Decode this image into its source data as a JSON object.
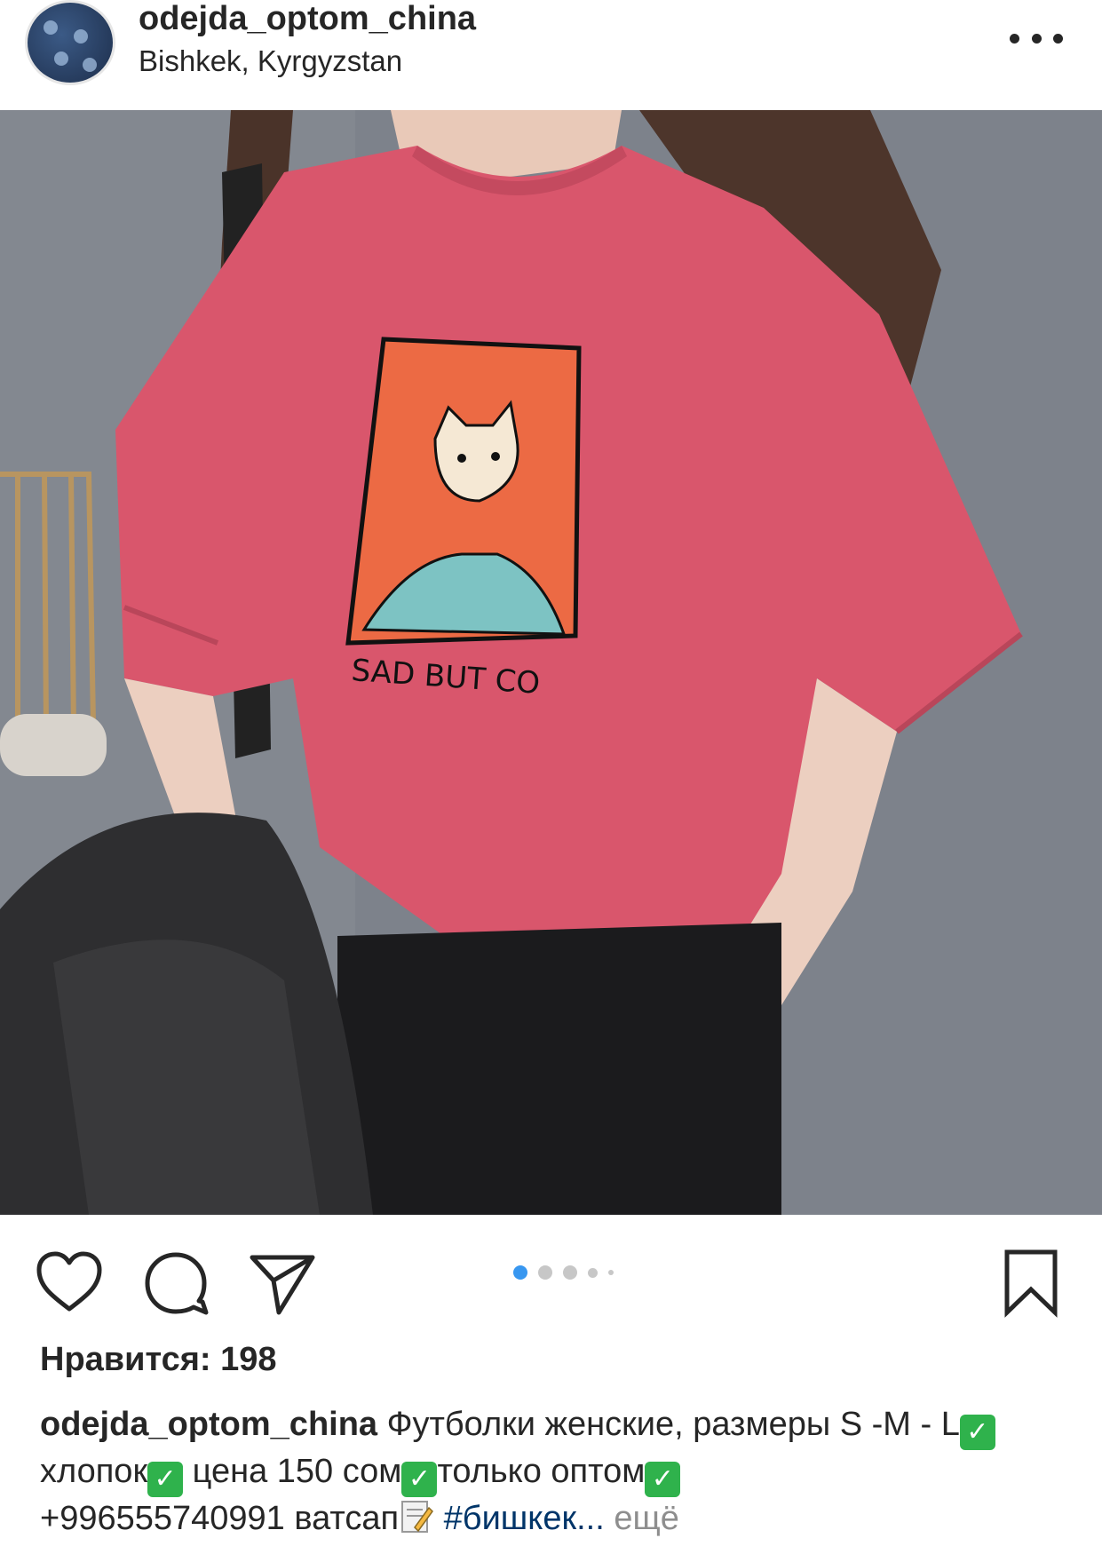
{
  "post": {
    "username": "odejda_optom_china",
    "location": "Bishkek, Kyrgyzstan",
    "shirt_print_text": "SAD BUT CO",
    "likes_label": "Нравится: 198",
    "carousel": {
      "pages": 5,
      "active_index": 0
    },
    "caption": {
      "username": "odejda_optom_china",
      "part1": " Футболки женские, размеры S -M - L",
      "part2": " хлопок",
      "part3": " цена 150 сом",
      "part4": "только оптом",
      "part5": " +996555740991 ватсап",
      "hashtag": " #бишкек...",
      "more_label": " ещё"
    }
  },
  "icons": {
    "more": "more-dots-icon",
    "like": "heart-icon",
    "comment": "comment-bubble-icon",
    "share": "paper-plane-icon",
    "save": "bookmark-icon",
    "check": "check-mark-icon",
    "memo": "memo-icon"
  },
  "colors": {
    "text": "#262626",
    "secondary_text": "#8e8e8e",
    "hashtag": "#003569",
    "carousel_active": "#3897f0",
    "carousel_inactive": "#c7c7c7",
    "check_emoji": "#2fb24c",
    "shirt": "#d9566c"
  }
}
